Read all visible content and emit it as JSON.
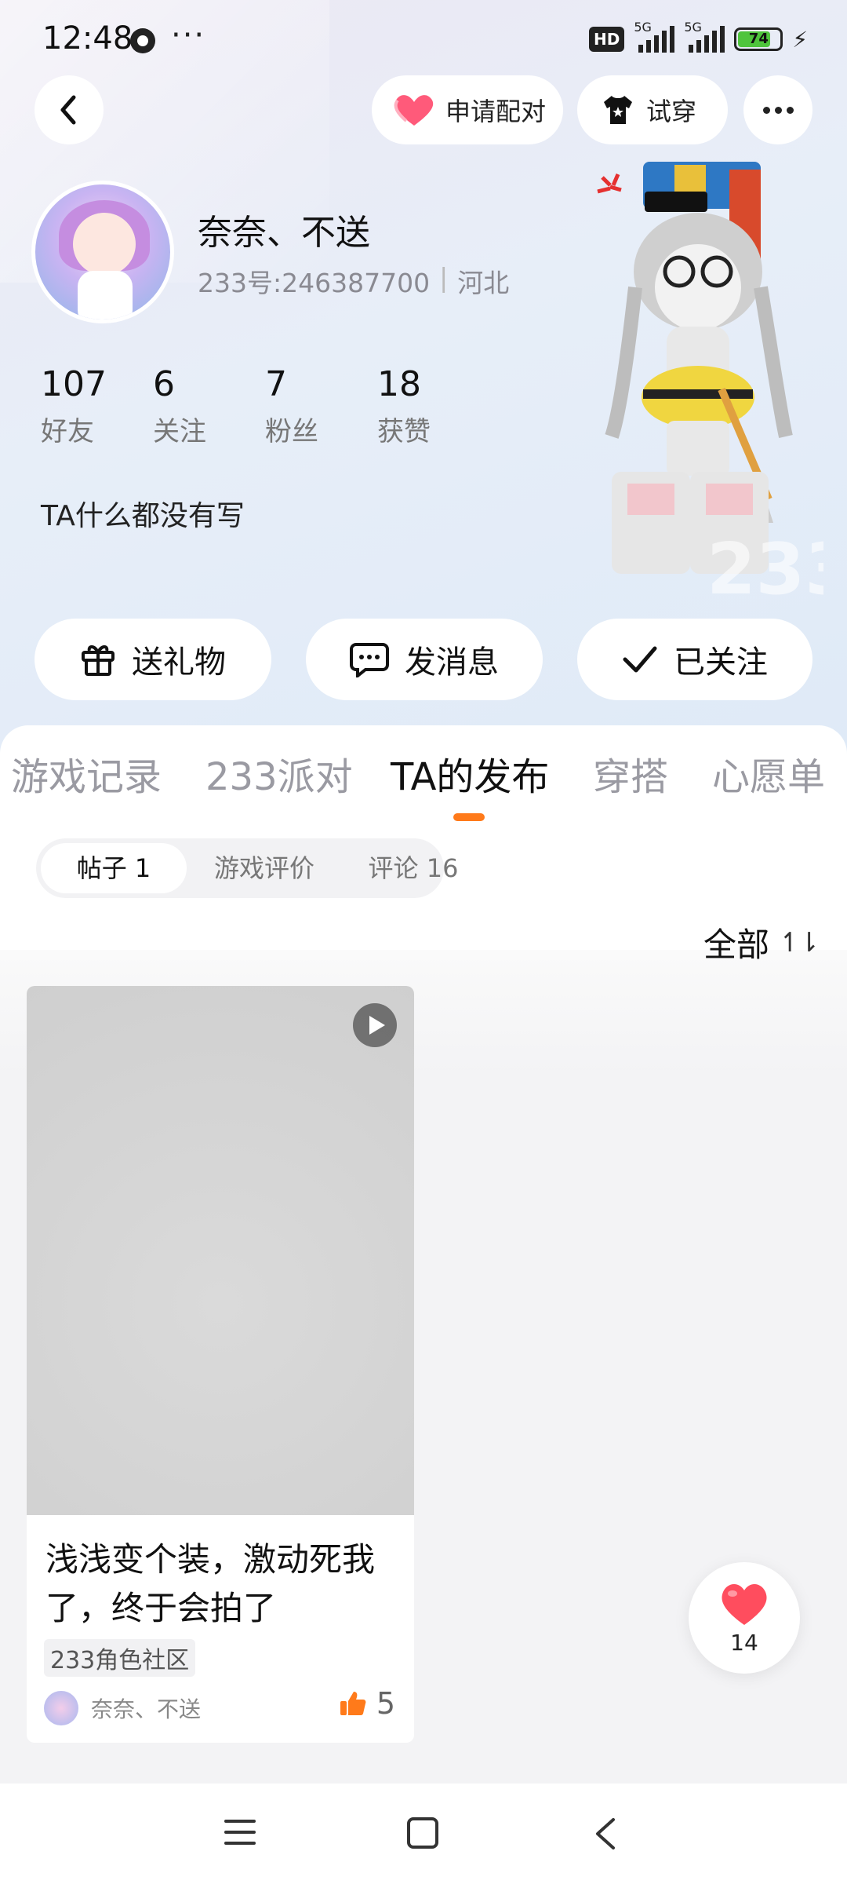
{
  "status_bar": {
    "time": "12:48",
    "more": "···",
    "hd": "HD",
    "signal1": "5G",
    "signal2": "5G",
    "battery": "74"
  },
  "header": {
    "pair_label": "申请配对",
    "try_label": "试穿"
  },
  "profile": {
    "name": "奈奈、不送",
    "uid": "233号:246387700",
    "location": "河北",
    "stats": [
      {
        "value": "107",
        "label": "好友"
      },
      {
        "value": "6",
        "label": "关注"
      },
      {
        "value": "7",
        "label": "粉丝"
      },
      {
        "value": "18",
        "label": "获赞"
      }
    ],
    "bio": "TA什么都没有写"
  },
  "actions": {
    "gift": "送礼物",
    "message": "发消息",
    "follow": "已关注"
  },
  "tabs": [
    "游戏记录",
    "233派对",
    "TA的发布",
    "穿搭",
    "心愿单"
  ],
  "active_tab": "TA的发布",
  "subtabs": [
    "帖子 1",
    "游戏评价",
    "评论 16"
  ],
  "sort_label": "全部",
  "post": {
    "title": "浅浅变个装，激动死我了，终于会拍了",
    "tag": "233角色社区",
    "author": "奈奈、不送",
    "likes": "5"
  },
  "fab": {
    "count": "14"
  },
  "colors": {
    "accent": "#ff7a1a",
    "heart": "#ff4d5e",
    "like": "#ff7a1a",
    "battery": "#4fc43c"
  },
  "icons": {
    "back": "chevron-left-icon",
    "pair": "heart-icon",
    "try": "tshirt-icon",
    "more": "more-dots-icon",
    "gift": "gift-icon",
    "message": "chat-icon",
    "follow": "check-icon",
    "play": "play-icon",
    "like": "thumbs-up-icon",
    "sort": "sort-icon"
  }
}
